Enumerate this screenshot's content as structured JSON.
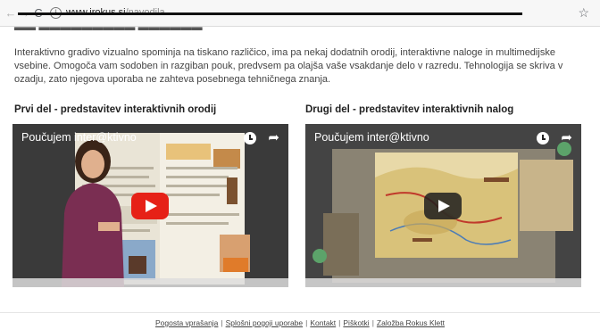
{
  "browser": {
    "url_domain": "www.irokus.si",
    "url_path": "/navodila"
  },
  "intro": {
    "paragraph": "Interaktivno gradivo vizualno spominja na tiskano različico, ima pa nekaj dodatnih orodij, interaktivne naloge in multimedijske vsebine. Omogoča vam sodoben in razgiban pouk, predvsem pa olajša vaše vsakdanje delo v razredu. Tehnologija se skriva v ozadju, zato njegova uporaba ne zahteva posebnega tehničnega znanja."
  },
  "sections": [
    {
      "heading": "Prvi del - predstavitev interaktivnih orodij",
      "video_title": "Poučujem inter@ktivno"
    },
    {
      "heading": "Drugi del - predstavitev interaktivnih nalog",
      "video_title": "Poučujem inter@ktivno"
    }
  ],
  "footer": {
    "links": [
      "Pogosta vprašanja",
      "Splošni pogoji uporabe",
      "Kontakt",
      "Piškotki",
      "Založba Rokus Klett"
    ],
    "separator": "|"
  },
  "colors": {
    "play_button_red": "#e62117",
    "video_title": "#ffffff"
  }
}
